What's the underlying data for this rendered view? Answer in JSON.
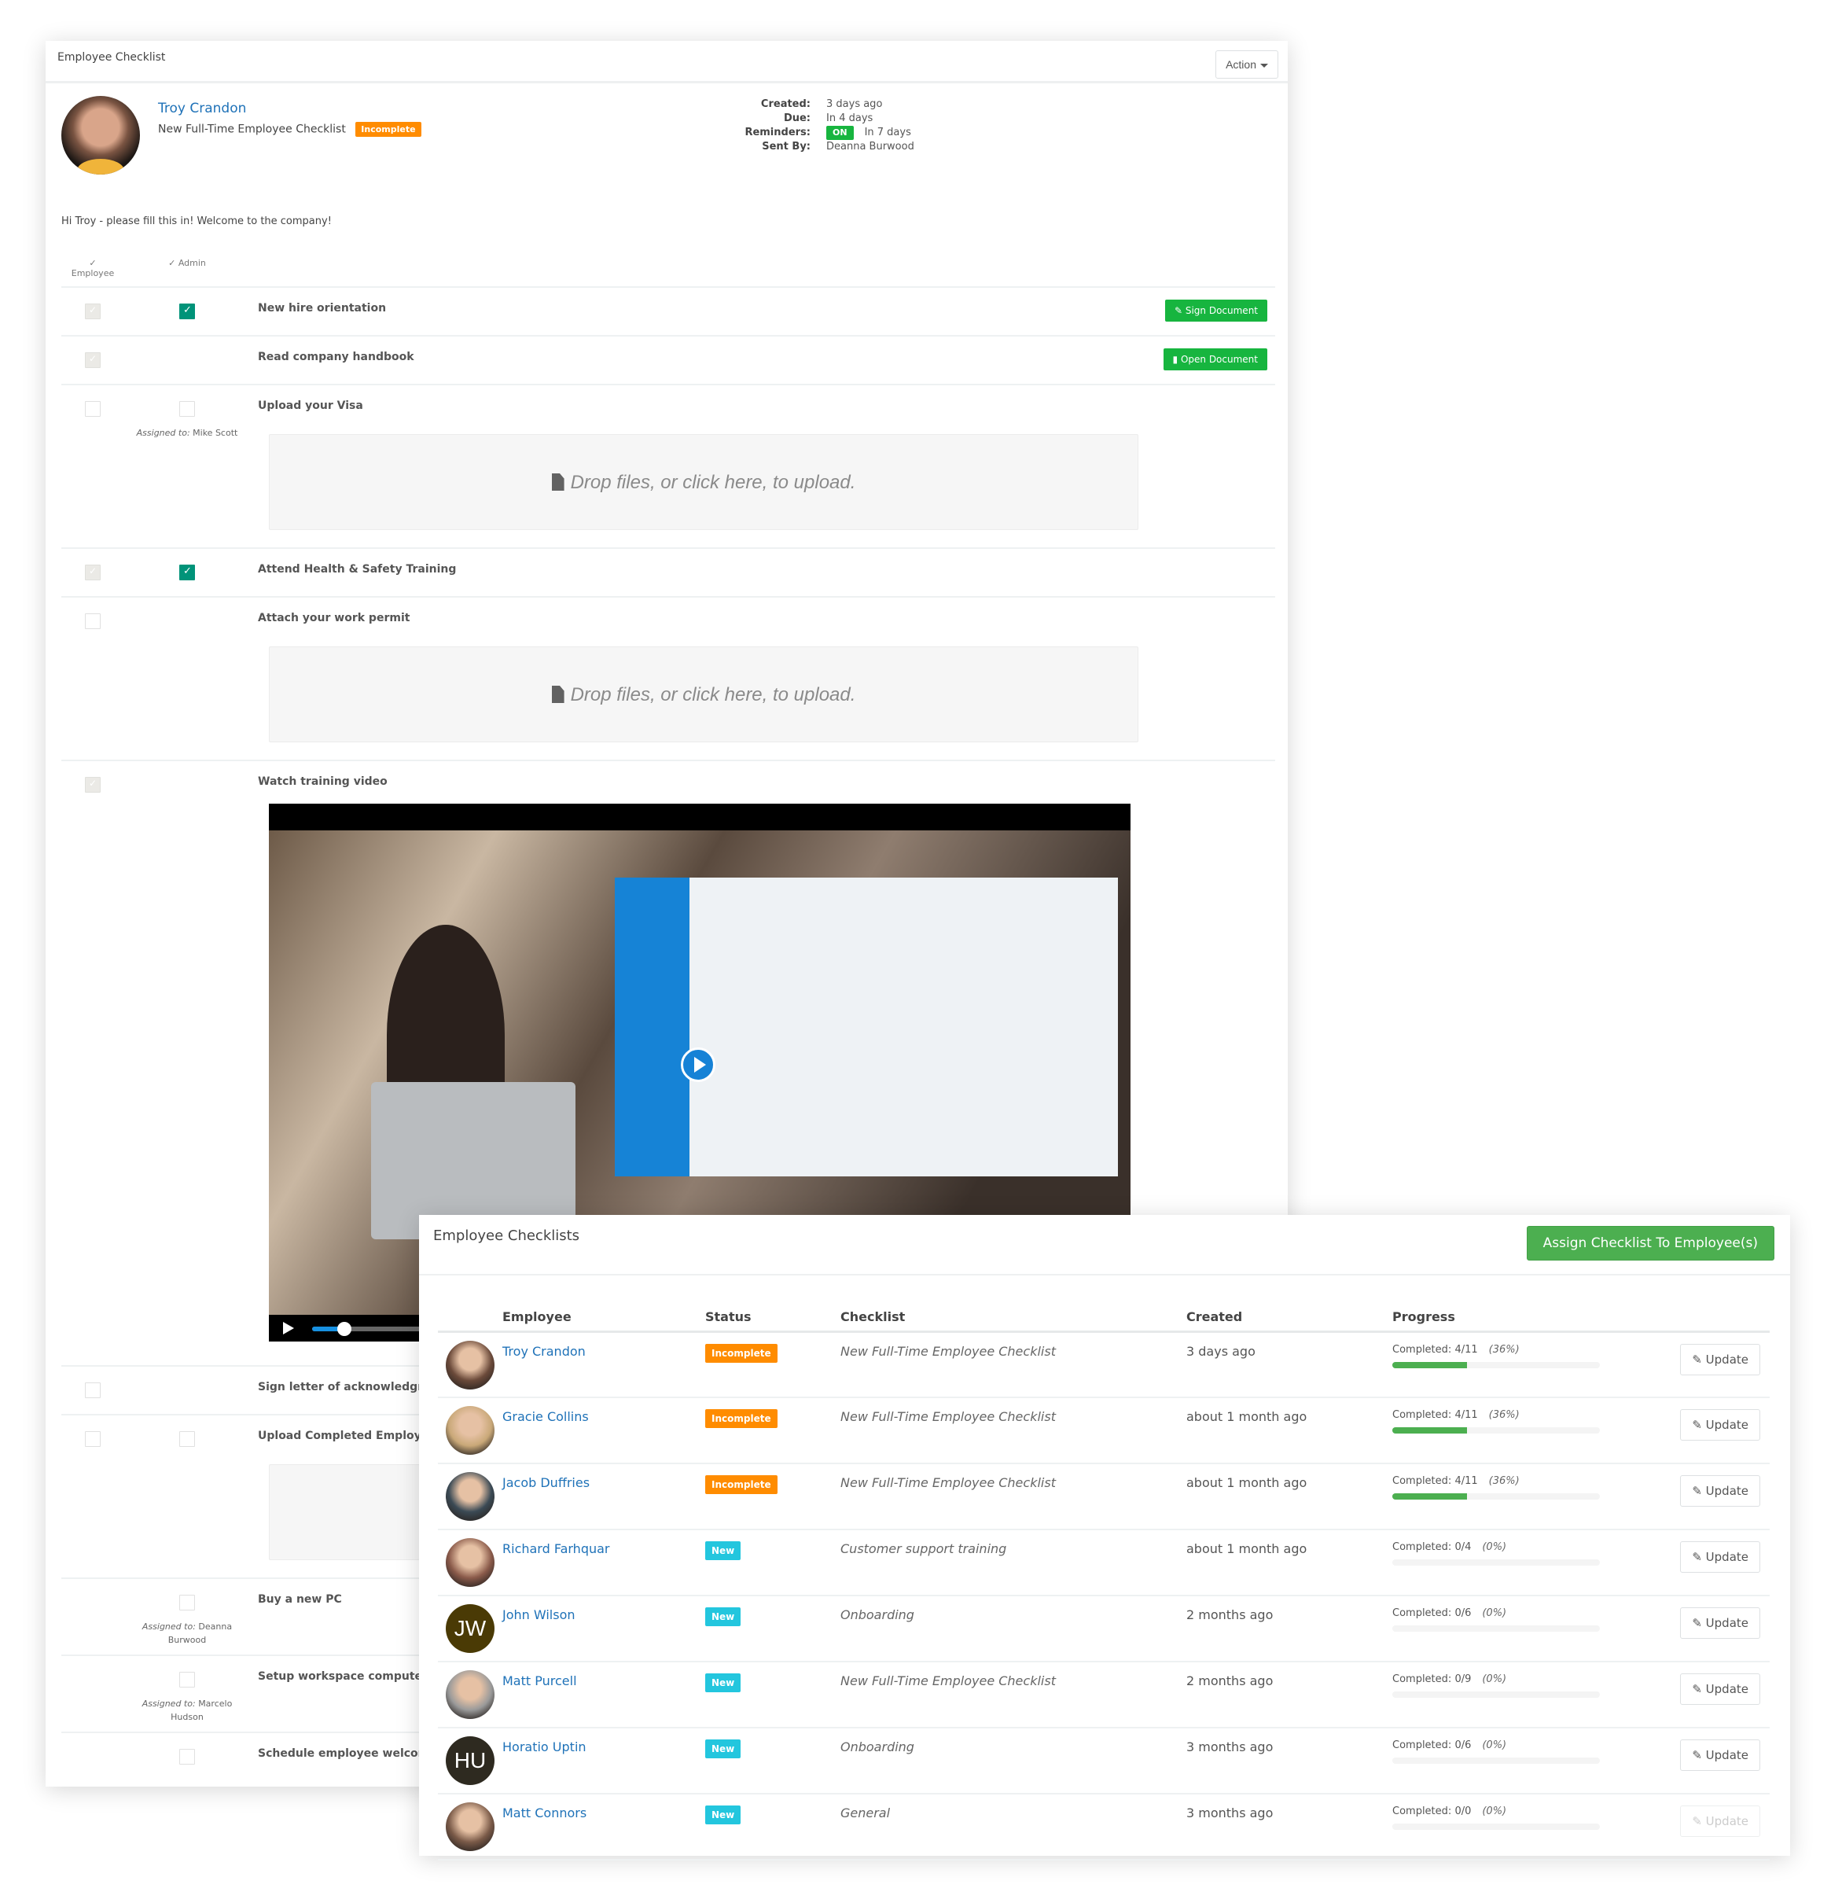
{
  "checklist_card": {
    "title": "Employee Checklist",
    "action_label": "Action",
    "employee_name": "Troy Crandon",
    "checklist_name": "New Full-Time Employee Checklist",
    "status": "Incomplete",
    "meta": {
      "created_label": "Created:",
      "created_value": "3 days ago",
      "due_label": "Due:",
      "due_value": "In 4 days",
      "reminders_label": "Reminders:",
      "reminders_toggle": "ON",
      "reminders_value": "In 7 days",
      "sent_by_label": "Sent By:",
      "sent_by_value": "Deanna Burwood"
    },
    "greeting": "Hi Troy - please fill this in! Welcome to the company!",
    "col_employee": "Employee",
    "col_admin": "Admin",
    "assigned_prefix": "Assigned to:",
    "dropzone_text": "Drop files, or click here, to upload.",
    "items": [
      {
        "label": "New hire orientation",
        "employee_check": "checked-disabled",
        "admin_check": "checked",
        "button": "Sign Document"
      },
      {
        "label": "Read company handbook",
        "employee_check": "checked-disabled",
        "admin_check": "none",
        "button": "Open Document"
      },
      {
        "label": "Upload your Visa",
        "employee_check": "unchecked",
        "admin_check": "unchecked",
        "assigned_to": "Mike Scott",
        "has_dropzone": true
      },
      {
        "label": "Attend Health & Safety Training",
        "employee_check": "checked-disabled",
        "admin_check": "checked"
      },
      {
        "label": "Attach your work permit",
        "employee_check": "unchecked",
        "admin_check": "none",
        "has_dropzone": true
      },
      {
        "label": "Watch training video",
        "employee_check": "checked-disabled",
        "admin_check": "none",
        "has_video": true,
        "video_progress": 0.04
      },
      {
        "label": "Sign letter of acknowledgmen",
        "employee_check": "unchecked",
        "admin_check": "none"
      },
      {
        "label": "Upload Completed Employme",
        "employee_check": "unchecked",
        "admin_check": "unchecked",
        "has_dropzone": true
      },
      {
        "label": "Buy a new PC",
        "employee_check": "none",
        "admin_check": "unchecked",
        "assigned_to": "Deanna Burwood"
      },
      {
        "label": "Setup workspace computer - f",
        "employee_check": "none",
        "admin_check": "unchecked",
        "assigned_to": "Marcelo Hudson"
      },
      {
        "label": "Schedule employee welcome l",
        "employee_check": "none",
        "admin_check": "unchecked"
      }
    ]
  },
  "checklists_panel": {
    "title": "Employee Checklists",
    "assign_button": "Assign Checklist To Employee(s)",
    "columns": [
      "Employee",
      "Status",
      "Checklist",
      "Created",
      "Progress"
    ],
    "update_label": "Update",
    "completed_prefix": "Completed:",
    "rows": [
      {
        "name": "Troy Crandon",
        "avatar": "photo",
        "avatar_color": "#6b4a3a",
        "status": "Incomplete",
        "checklist": "New Full-Time Employee Checklist",
        "created": "3 days ago",
        "completed": "4/11",
        "percent": "(36%)",
        "progress": 0.36,
        "update_enabled": true
      },
      {
        "name": "Gracie Collins",
        "avatar": "photo",
        "avatar_color": "#c9a878",
        "status": "Incomplete",
        "checklist": "New Full-Time Employee Checklist",
        "created": "about 1 month ago",
        "completed": "4/11",
        "percent": "(36%)",
        "progress": 0.36,
        "update_enabled": true
      },
      {
        "name": "Jacob Duffries",
        "avatar": "photo",
        "avatar_color": "#3b4a55",
        "status": "Incomplete",
        "checklist": "New Full-Time Employee Checklist",
        "created": "about 1 month ago",
        "completed": "4/11",
        "percent": "(36%)",
        "progress": 0.36,
        "update_enabled": true
      },
      {
        "name": "Richard Farhquar",
        "avatar": "photo",
        "avatar_color": "#8a5a4a",
        "status": "New",
        "checklist": "Customer support training",
        "created": "about 1 month ago",
        "completed": "0/4",
        "percent": "(0%)",
        "progress": 0,
        "update_enabled": true
      },
      {
        "name": "John Wilson",
        "avatar": "JW",
        "avatar_color": "#4a3a05",
        "status": "New",
        "checklist": "Onboarding",
        "created": "2 months ago",
        "completed": "0/6",
        "percent": "(0%)",
        "progress": 0,
        "update_enabled": true
      },
      {
        "name": "Matt Purcell",
        "avatar": "photo",
        "avatar_color": "#9a9a9a",
        "status": "New",
        "checklist": "New Full-Time Employee Checklist",
        "created": "2 months ago",
        "completed": "0/9",
        "percent": "(0%)",
        "progress": 0,
        "update_enabled": true
      },
      {
        "name": "Horatio Uptin",
        "avatar": "HU",
        "avatar_color": "#2e2a20",
        "status": "New",
        "checklist": "Onboarding",
        "created": "3 months ago",
        "completed": "0/6",
        "percent": "(0%)",
        "progress": 0,
        "update_enabled": true
      },
      {
        "name": "Matt Connors",
        "avatar": "photo",
        "avatar_color": "#7a5a48",
        "status": "New",
        "checklist": "General",
        "created": "3 months ago",
        "completed": "0/0",
        "percent": "(0%)",
        "progress": 0,
        "update_enabled": false
      }
    ]
  },
  "colors": {
    "link": "#1f72b8",
    "incomplete": "#ff8c00",
    "new": "#23c6de",
    "green": "#17b53f",
    "admin_check": "#009379",
    "progress": "#4caf50"
  }
}
